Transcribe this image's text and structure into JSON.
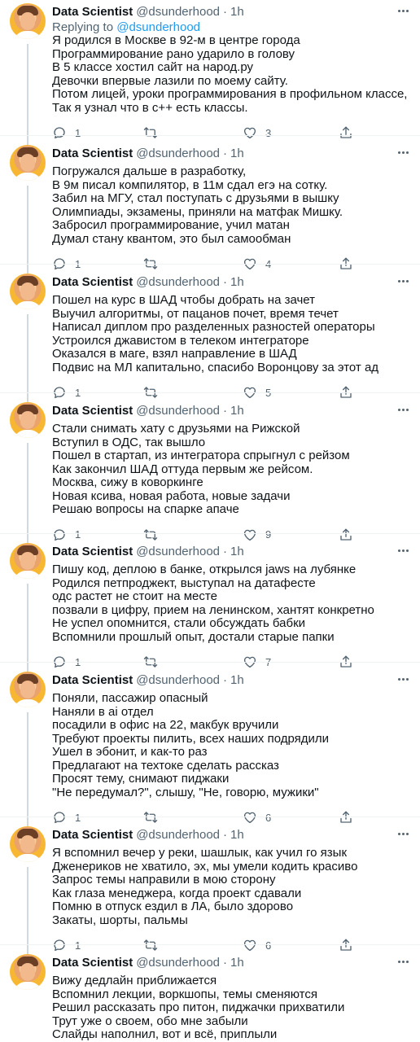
{
  "author": {
    "name": "Data Scientist",
    "handle": "@dsunderhood",
    "dot": "·",
    "time": "1h"
  },
  "replying": {
    "prefix": "Replying to",
    "handle": "@dsunderhood"
  },
  "tweets": [
    {
      "lines": [
        "Я родился в Москве в 92-м в центре города",
        "Программирование рано ударило в голову",
        "В 5 классе хостил сайт на народ.ру",
        "Девочки впервые лазили по моему сайту.",
        "Потом лицей, уроки программирования в профильном классе,",
        "Так я узнал что в с++ есть классы."
      ],
      "replies": "1",
      "retweets": "",
      "likes": "3"
    },
    {
      "lines": [
        "Погружался дальше в разработку,",
        "В 9м писал компилятор, в 11м сдал егэ на сотку.",
        "Забил на МГУ, стал поступать с друзьями в вышку",
        "Олимпиады, экзамены, приняли на матфак Мишку.",
        "Забросил программирование, учил матан",
        "Думал стану квантом, это был самообман"
      ],
      "replies": "1",
      "retweets": "",
      "likes": "4"
    },
    {
      "lines": [
        "Пошел на курс в ШАД чтобы добрать на зачет",
        "Выучил алгоритмы, от пацанов почет, время течет",
        "Написал диплом про разделенных разностей операторы",
        "Устроился джавистом в телеком интеграторе",
        "Оказался в маге, взял направление в ШАД",
        "Подвис на МЛ капитально, спасибо Воронцову за этот ад"
      ],
      "replies": "1",
      "retweets": "",
      "likes": "5"
    },
    {
      "lines": [
        "Стали снимать хату с друзьями на Рижской",
        "Вступил в ОДС, так вышло",
        "Пошел в стартап, из интегратора спрыгнул с рейзом",
        "Как закончил ШАД оттуда первым же рейсом.",
        "Москва, сижу в коворкинге",
        "Новая ксива, новая работа, новые задачи",
        "Решаю вопросы на спарке апаче"
      ],
      "replies": "1",
      "retweets": "",
      "likes": "9"
    },
    {
      "lines": [
        "Пишу код, деплою в банке, открылся jaws на лубянке",
        "Родился петпроджект, выступал на датафесте",
        "одс растет не стоит на месте",
        "позвали в цифру, прием на ленинском, хантят конкретно",
        "Не успел опомнится, стали обсуждать бабки",
        "Вспомнили прошлый опыт, достали старые папки"
      ],
      "replies": "1",
      "retweets": "",
      "likes": "7"
    },
    {
      "lines": [
        "Поняли, пассажир опасный",
        "Наняли в ai отдел",
        "посадили в офис на 22, макбук вручили",
        "Требуют проекты пилить, всех наших подрядили",
        "Ушел в эбонит, и как-то раз",
        "Предлагают на техтоке сделать рассказ",
        "Просят тему, снимают пиджаки",
        "\"Не передумал?\", слышу, \"Не, говорю, мужики\""
      ],
      "replies": "1",
      "retweets": "",
      "likes": "6"
    },
    {
      "lines": [
        "Я вспомнил вечер у реки, шашлык, как учил го язык",
        "Дженериков не хватило, эх, мы умели кодить красиво",
        "Запрос темы направили в мою сторону",
        "Как глаза менеджера, когда проект сдавали",
        "Помню в отпуск ездил в ЛА, было здорово",
        "Закаты, шорты, пальмы"
      ],
      "replies": "1",
      "retweets": "",
      "likes": "6"
    },
    {
      "lines": [
        "Вижу дедлайн приближается",
        "Вспомнил лекции, воркшопы, темы сменяются",
        "Решил рассказать про питон, пиджачки прихватили",
        "Трут уже о своем, обо мне забыли",
        "Слайды наполнил, вот и всё, приплыли"
      ],
      "replies": "",
      "retweets": "",
      "likes": ""
    }
  ]
}
